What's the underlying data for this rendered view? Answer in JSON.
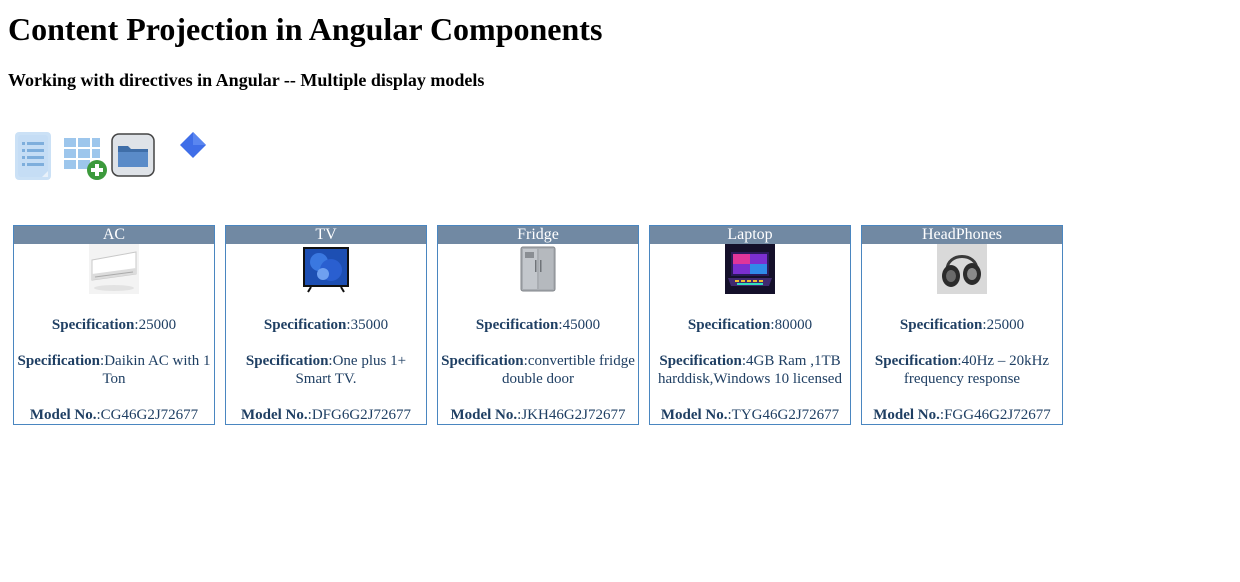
{
  "page": {
    "title": "Content Projection in Angular Components",
    "subtitle": "Working with directives in Angular -- Multiple display models"
  },
  "toolbar": {
    "icons": [
      "list-view-icon",
      "table-add-icon",
      "folder-icon",
      "diamond-icon"
    ]
  },
  "labels": {
    "specification": "Specification",
    "separator": ":",
    "model_no": "Model No."
  },
  "products": [
    {
      "name": "AC",
      "price": "25000",
      "description": "Daikin AC with 1 Ton",
      "model": "CG46G2J72677",
      "icon": "air-conditioner-image"
    },
    {
      "name": "TV",
      "price": "35000",
      "description": "One plus 1+ Smart TV.",
      "model": "DFG6G2J72677",
      "icon": "television-image"
    },
    {
      "name": "Fridge",
      "price": "45000",
      "description": "convertible fridge double door",
      "model": "JKH46G2J72677",
      "icon": "fridge-image"
    },
    {
      "name": "Laptop",
      "price": "80000",
      "description": "4GB Ram ,1TB harddisk,Windows 10 licensed",
      "model": "TYG46G2J72677",
      "icon": "laptop-image"
    },
    {
      "name": "HeadPhones",
      "price": "25000",
      "description": "40Hz – 20kHz frequency response",
      "model": "FGG46G2J72677",
      "icon": "headphones-image"
    }
  ]
}
